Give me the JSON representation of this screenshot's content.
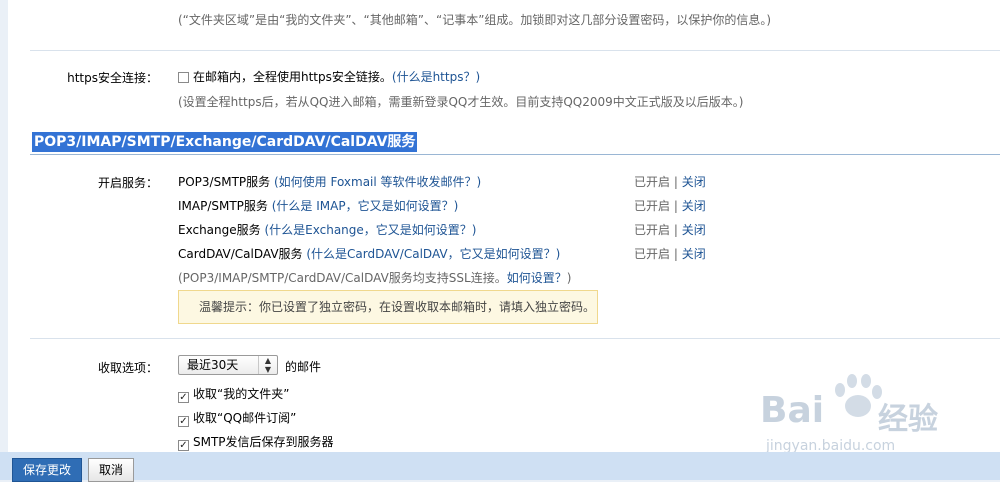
{
  "folder_note": "(“文件夹区域”是由“我的文件夹”、“其他邮箱”、“记事本”组成。加锁即对这几部分设置密码，以保护你的信息。)",
  "https": {
    "label": "https安全连接：",
    "checkbox_text": "在邮箱内，全程使用https安全链接。",
    "link_open": "(",
    "link": "什么是https？",
    "link_close": ")",
    "note": "(设置全程https后，若从QQ进入邮箱，需重新登录QQ才生效。目前支持QQ2009中文正式版及以后版本。)"
  },
  "section_title": "POP3/IMAP/SMTP/Exchange/CardDAV/CalDAV服务",
  "services": {
    "label": "开启服务：",
    "items": [
      {
        "name": "POP3/SMTP服务",
        "help": "(如何使用 Foxmail 等软件收发邮件？)",
        "status": "已开启",
        "sep": "|",
        "action": "关闭"
      },
      {
        "name": "IMAP/SMTP服务",
        "help": "(什么是 IMAP，它又是如何设置？)",
        "status": "已开启",
        "sep": "|",
        "action": "关闭"
      },
      {
        "name": "Exchange服务",
        "help": "(什么是Exchange，它又是如何设置？)",
        "status": "已开启",
        "sep": "|",
        "action": "关闭"
      },
      {
        "name": "CardDAV/CalDAV服务",
        "help": "(什么是CardDAV/CalDAV，它又是如何设置？)",
        "status": "已开启",
        "sep": "|",
        "action": "关闭"
      }
    ],
    "ssl_note": "(POP3/IMAP/SMTP/CardDAV/CalDAV服务均支持SSL连接。",
    "ssl_link": "如何设置？",
    "ssl_close": ")",
    "notice": "温馨提示：你已设置了独立密码，在设置收取本邮箱时，请填入独立密码。"
  },
  "receive": {
    "label": "收取选项：",
    "select_value": "最近30天",
    "select_suffix": "的邮件",
    "options": [
      {
        "label": "收取“我的文件夹”",
        "checked": true
      },
      {
        "label": "收取“QQ邮件订阅”",
        "checked": true
      },
      {
        "label": "SMTP发信后保存到服务器",
        "checked": true
      }
    ]
  },
  "buttons": {
    "save": "保存更改",
    "cancel": "取消"
  },
  "watermark": {
    "brand": "Bai",
    "brand_tail": "经验",
    "url": "jingyan.baidu.com"
  }
}
